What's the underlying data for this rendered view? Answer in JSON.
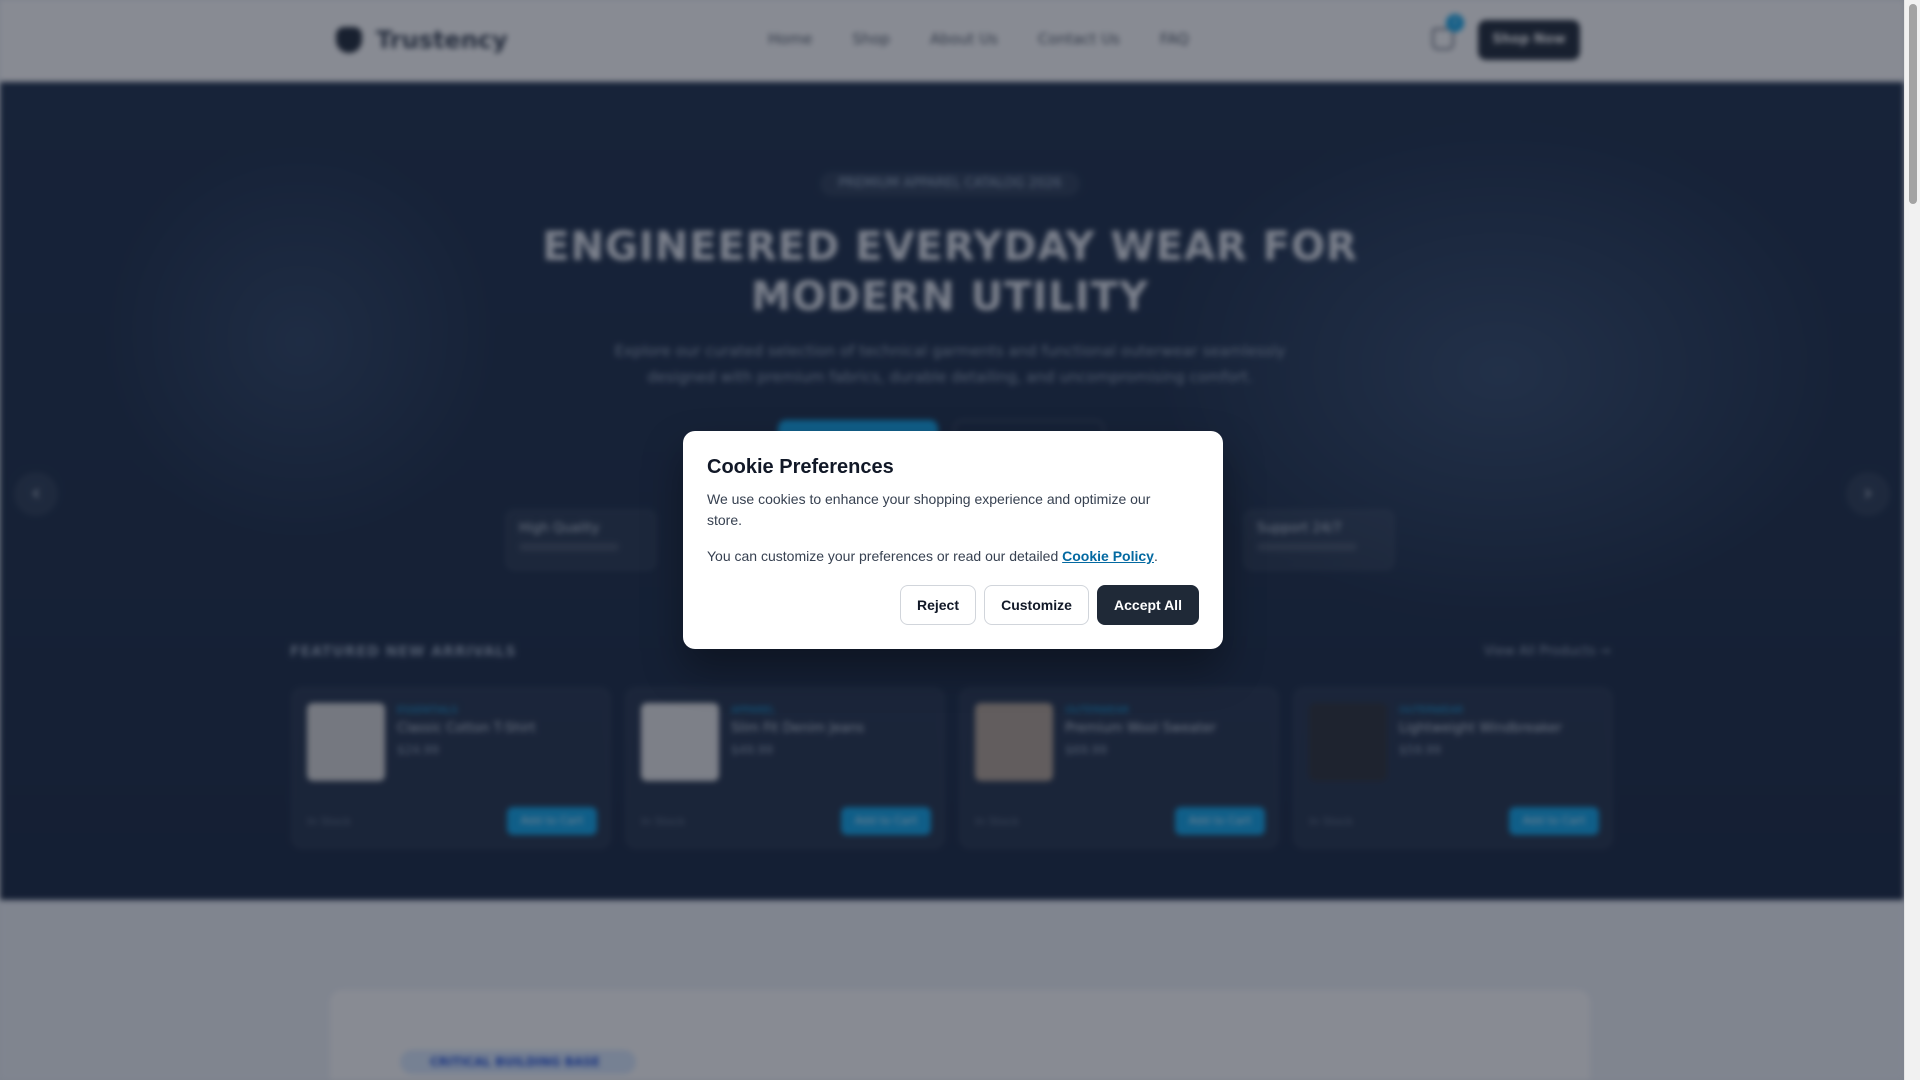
{
  "header": {
    "brand": "Trustency",
    "nav": [
      "Home",
      "Shop",
      "About Us",
      "Contact Us",
      "FAQ"
    ],
    "cart_count": "2",
    "shop_button": "Shop Now"
  },
  "hero": {
    "kicker": "PREMIUM APPAREL CATALOG 2026",
    "headline": "ENGINEERED EVERYDAY WEAR FOR MODERN UTILITY",
    "subline": "Explore our curated selection of technical garments and functional outerwear seamlessly designed with premium fabrics, durable detailing, and uncompromising comfort.",
    "features": [
      "High Quality",
      "Support 24/7"
    ],
    "prev_arrow": "‹",
    "next_arrow": "›"
  },
  "featured": {
    "title": "FEATURED NEW ARRIVALS",
    "view_all": "View All Products →",
    "products": [
      {
        "category": "ESSENTIALS",
        "name": "Classic Cotton T-Shirt",
        "price": "$24.99",
        "stock": "In Stock",
        "add_label": "Add to Cart",
        "thumb_color": "#d9d9d9"
      },
      {
        "category": "APPAREL",
        "name": "Slim Fit Denim Jeans",
        "price": "$49.99",
        "stock": "In Stock",
        "add_label": "Add to Cart",
        "thumb_color": "#e8e8e8"
      },
      {
        "category": "OUTERWEAR",
        "name": "Premium Wool Sweater",
        "price": "$69.99",
        "stock": "In Stock",
        "add_label": "Add to Cart",
        "thumb_color": "#b3a394"
      },
      {
        "category": "OUTERWEAR",
        "name": "Lightweight Windbreaker",
        "price": "$59.99",
        "stock": "In Stock",
        "add_label": "Add to Cart",
        "thumb_color": "#2b2f36"
      }
    ]
  },
  "lower": {
    "badge": "CRITICAL BUILDING BASE"
  },
  "cookie": {
    "title": "Cookie Preferences",
    "text1": "We use cookies to enhance your shopping experience and optimize our store.",
    "text2_prefix": "You can customize your preferences or read our detailed ",
    "policy_link": "Cookie Policy",
    "text2_suffix": ".",
    "reject": "Reject",
    "customize": "Customize",
    "accept": "Accept All"
  }
}
